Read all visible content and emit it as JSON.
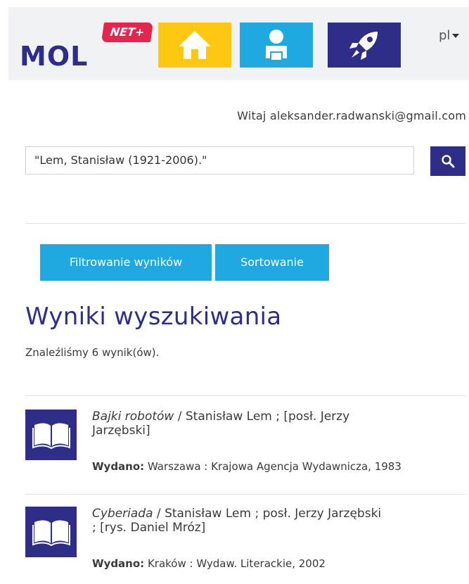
{
  "header": {
    "logo_text": "MOL",
    "logo_badge": "NET+",
    "nav": {
      "home_icon": "home-icon",
      "user_icon": "user-icon",
      "rocket_icon": "rocket-icon"
    },
    "language": "pl",
    "colors": {
      "yellow": "#fdc712",
      "blue": "#20a9e0",
      "navy": "#2e2d88",
      "red": "#e2264d"
    }
  },
  "welcome_text": "Witaj aleksander.radwanski@gmail.com",
  "search": {
    "value": "\"Lem, Stanisław (1921-2006).\"",
    "icon": "search-icon"
  },
  "buttons": {
    "filter": "Filtrowanie wyników",
    "sort": "Sortowanie"
  },
  "results": {
    "title": "Wyniki wyszukiwania",
    "count_text": "Znaleźliśmy 6 wynik(ów).",
    "items": [
      {
        "title": "Bajki robotów",
        "rest": " / Stanisław Lem ; [posł. Jerzy Jarzębski]",
        "pub_label": "Wydano:",
        "pub_value": " Warszawa : Krajowa Agencja Wydawnicza, 1983"
      },
      {
        "title": "Cyberiada",
        "rest": " / Stanisław Lem ; posł. Jerzy Jarzębski ; [rys. Daniel Mróz]",
        "pub_label": "Wydano:",
        "pub_value": " Kraków : Wydaw. Literackie, 2002"
      }
    ]
  }
}
